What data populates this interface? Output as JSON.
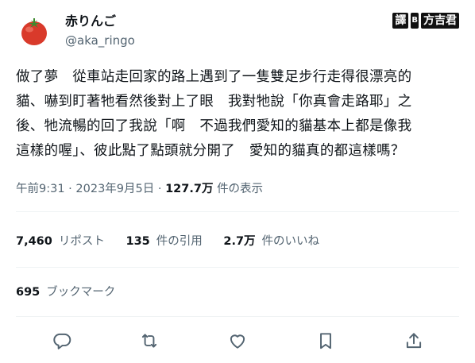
{
  "user": {
    "name": "赤りんご",
    "handle": "@aka_ringo",
    "avatar_icon": "tomato-avatar-icon"
  },
  "watermark": {
    "part1": "譯",
    "part2": "B",
    "part3": "方吉君"
  },
  "tweet": {
    "lines": [
      "做了夢　從車站走回家的路上遇到了一隻雙足步行走得很漂亮的",
      "貓、嚇到盯著牠看然後對上了眼　我對牠說「你真會走路耶」之",
      "後、牠流暢的回了我說「啊　不過我們愛知的貓基本上都是像我",
      "這樣的喔」、彼此點了點頭就分開了　愛知的貓真的都這樣嗎？"
    ]
  },
  "meta": {
    "time": "午前9:31",
    "separator": "·",
    "date": "2023年9月5日",
    "views_count": "127.7万",
    "views_label": "件の表示"
  },
  "stats": {
    "reposts_count": "7,460",
    "reposts_label": "リポスト",
    "quotes_count": "135",
    "quotes_label": "件の引用",
    "likes_count": "2.7万",
    "likes_label": "件のいいね"
  },
  "bookmarks": {
    "count": "695",
    "label": "ブックマーク"
  },
  "actions": {
    "icons": [
      "reply-icon",
      "repost-icon",
      "like-icon",
      "bookmark-icon",
      "share-icon"
    ],
    "icon_color": "#536471"
  }
}
